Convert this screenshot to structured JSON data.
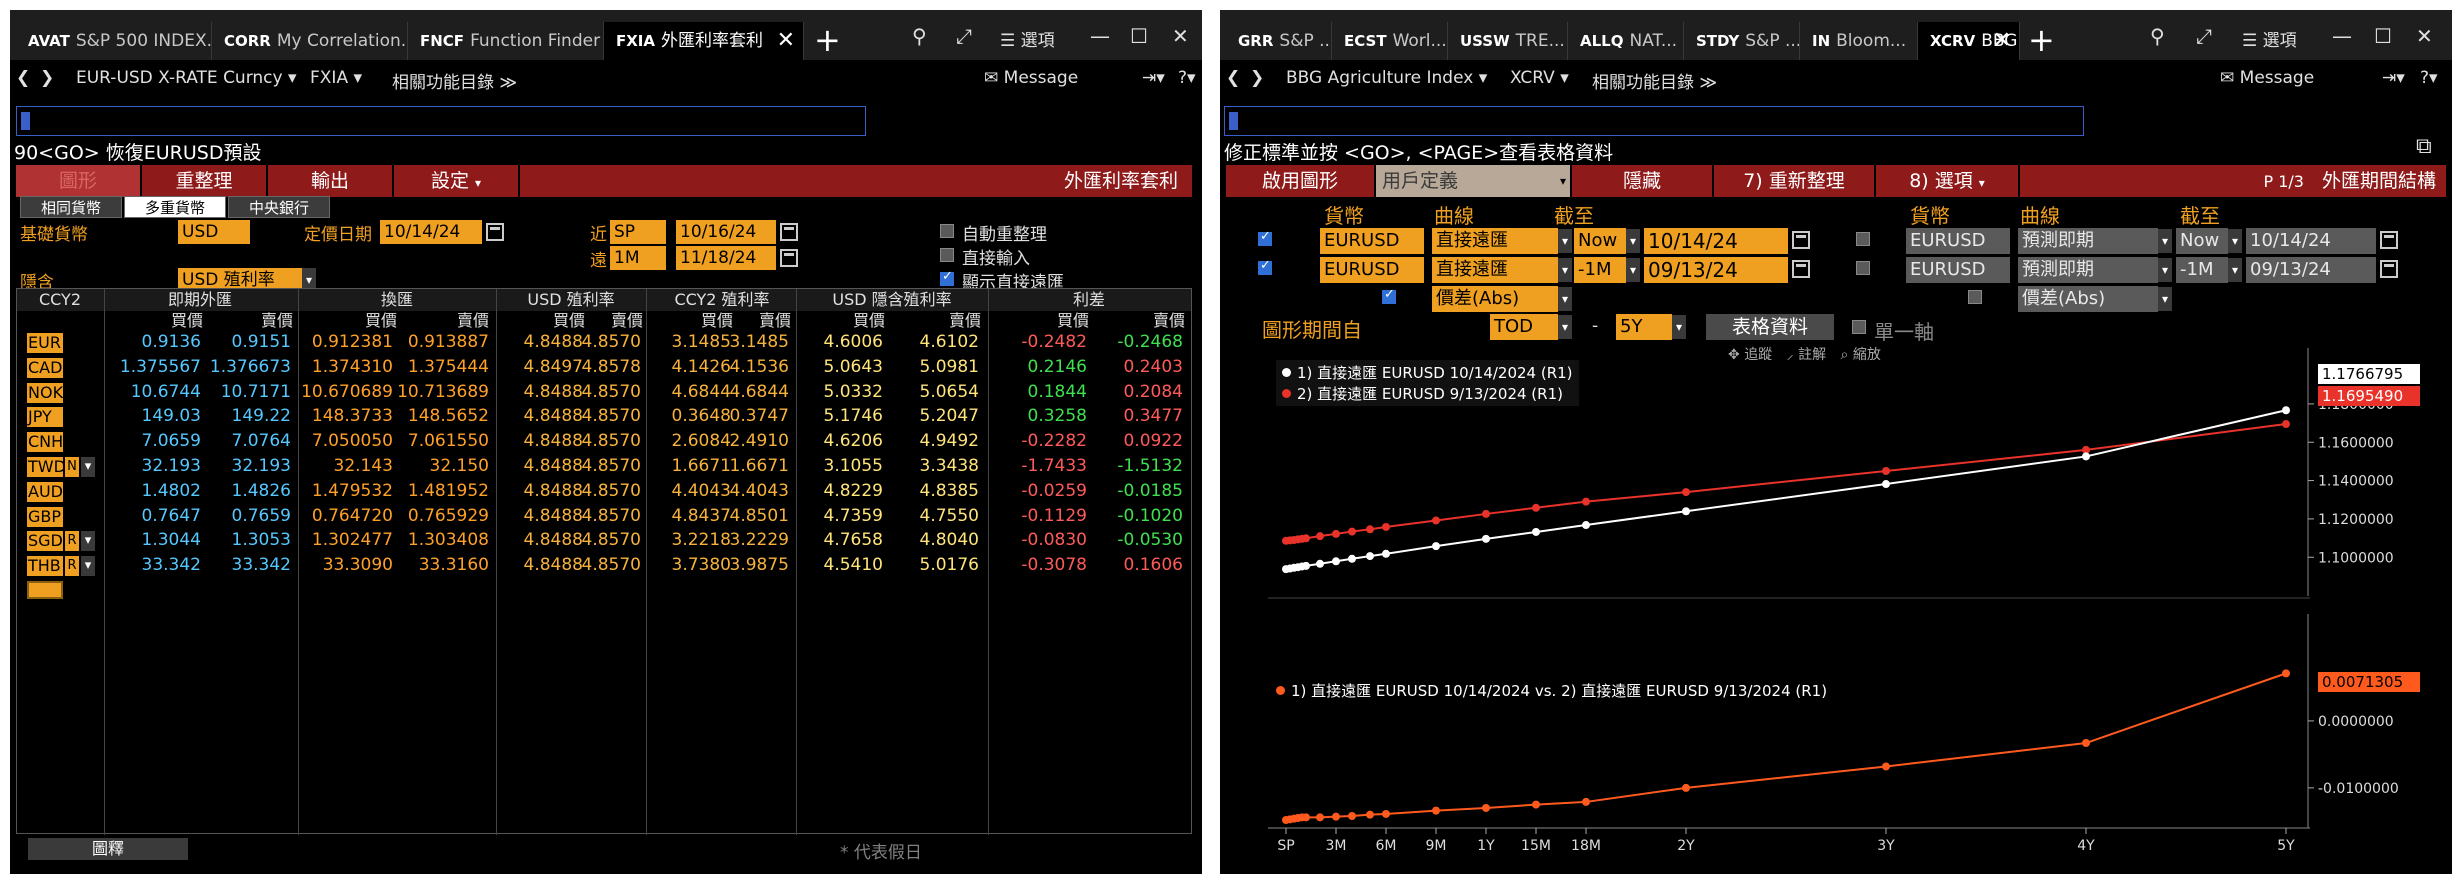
{
  "left": {
    "tabs": [
      {
        "code": "AVAT",
        "label": "S&P 500 INDEX..."
      },
      {
        "code": "CORR",
        "label": "My Correlation..."
      },
      {
        "code": "FNCF",
        "label": "Function Finder"
      },
      {
        "code": "FXIA",
        "label": "外匯利率套利"
      }
    ],
    "options_label": "選項",
    "cmdbar": {
      "security": "EUR-USD X-RATE Curncy",
      "function": "FXIA",
      "related": "相關功能目錄",
      "message": "Message"
    },
    "status_line": "90<GO> 恢復EURUSD預設",
    "redbar": {
      "chart": "圖形",
      "reorganize": "重整理",
      "output": "輸出",
      "settings": "設定",
      "title": "外匯利率套利"
    },
    "subtabs": [
      "相同貨幣",
      "多重貨幣",
      "中央銀行"
    ],
    "form": {
      "base_ccy_label": "基礎貨幣",
      "base_ccy_value": "USD",
      "value_date_label": "定價日期",
      "value_date": "10/14/24",
      "near_label": "近",
      "near_tenor": "SP",
      "near_date": "10/16/24",
      "far_label": "遠",
      "far_tenor": "1M",
      "far_date": "11/18/24",
      "implied_label": "隱含",
      "implied_value": "USD 殖利率",
      "opt_auto": "自動重整理",
      "opt_direct": "直接輸入",
      "opt_show": "顯示直接遠匯"
    },
    "table": {
      "headers": {
        "ccy2": "CCY2",
        "spot": "即期外匯",
        "swap": "換匯",
        "usd_yield": "USD 殖利率",
        "ccy2_yield": "CCY2 殖利率",
        "implied": "USD 隱含殖利率",
        "spread": "利差",
        "bid": "買價",
        "ask": "賣價"
      },
      "rows": [
        {
          "ccy": "EUR",
          "sb": "0.9136",
          "sa": "0.9151",
          "wb": "0.912381",
          "wa": "0.913887",
          "ub": "4.8488",
          "ua": "4.8570",
          "cb": "3.1485",
          "ca": "3.1485",
          "ib": "4.6006",
          "ia": "4.6102",
          "pb": "-0.2482",
          "pa": "-0.2468"
        },
        {
          "ccy": "CAD",
          "sb": "1.375567",
          "sa": "1.376673",
          "wb": "1.374310",
          "wa": "1.375444",
          "ub": "4.8497",
          "ua": "4.8578",
          "cb": "4.1426",
          "ca": "4.1536",
          "ib": "5.0643",
          "ia": "5.0981",
          "pb": "0.2146",
          "pa": "0.2403"
        },
        {
          "ccy": "NOK",
          "sb": "10.6744",
          "sa": "10.7171",
          "wb": "10.670689",
          "wa": "10.713689",
          "ub": "4.8488",
          "ua": "4.8570",
          "cb": "4.6844",
          "ca": "4.6844",
          "ib": "5.0332",
          "ia": "5.0654",
          "pb": "0.1844",
          "pa": "0.2084"
        },
        {
          "ccy": "JPY",
          "sb": "149.03",
          "sa": "149.22",
          "wb": "148.3733",
          "wa": "148.5652",
          "ub": "4.8488",
          "ua": "4.8570",
          "cb": "0.3648",
          "ca": "0.3747",
          "ib": "5.1746",
          "ia": "5.2047",
          "pb": "0.3258",
          "pa": "0.3477"
        },
        {
          "ccy": "CNH",
          "sb": "7.0659",
          "sa": "7.0764",
          "wb": "7.050050",
          "wa": "7.061550",
          "ub": "4.8488",
          "ua": "4.8570",
          "cb": "2.6084",
          "ca": "2.4910",
          "ib": "4.6206",
          "ia": "4.9492",
          "pb": "-0.2282",
          "pa": "0.0922"
        },
        {
          "ccy": "TWD",
          "flag": "N",
          "sb": "32.193",
          "sa": "32.193",
          "wb": "32.143",
          "wa": "32.150",
          "ub": "4.8488",
          "ua": "4.8570",
          "cb": "1.6671",
          "ca": "1.6671",
          "ib": "3.1055",
          "ia": "3.3438",
          "pb": "-1.7433",
          "pa": "-1.5132"
        },
        {
          "ccy": "AUD",
          "sb": "1.4802",
          "sa": "1.4826",
          "wb": "1.479532",
          "wa": "1.481952",
          "ub": "4.8488",
          "ua": "4.8570",
          "cb": "4.4043",
          "ca": "4.4043",
          "ib": "4.8229",
          "ia": "4.8385",
          "pb": "-0.0259",
          "pa": "-0.0185"
        },
        {
          "ccy": "GBP",
          "sb": "0.7647",
          "sa": "0.7659",
          "wb": "0.764720",
          "wa": "0.765929",
          "ub": "4.8488",
          "ua": "4.8570",
          "cb": "4.8437",
          "ca": "4.8501",
          "ib": "4.7359",
          "ia": "4.7550",
          "pb": "-0.1129",
          "pa": "-0.1020"
        },
        {
          "ccy": "SGD",
          "flag": "R",
          "sb": "1.3044",
          "sa": "1.3053",
          "wb": "1.302477",
          "wa": "1.303408",
          "ub": "4.8488",
          "ua": "4.8570",
          "cb": "3.2218",
          "ca": "3.2229",
          "ib": "4.7658",
          "ia": "4.8040",
          "pb": "-0.0830",
          "pa": "-0.0530"
        },
        {
          "ccy": "THB",
          "flag": "R",
          "sb": "33.342",
          "sa": "33.342",
          "wb": "33.3090",
          "wa": "33.3160",
          "ub": "4.8488",
          "ua": "4.8570",
          "cb": "3.7380",
          "ca": "3.9875",
          "ib": "4.5410",
          "ia": "5.0176",
          "pb": "-0.3078",
          "pa": "0.1606"
        }
      ]
    },
    "legend_button": "圖釋",
    "holiday_note": "* 代表假日"
  },
  "right": {
    "tabs": [
      {
        "code": "GRR",
        "label": "S&P ..."
      },
      {
        "code": "ECST",
        "label": "Worl..."
      },
      {
        "code": "USSW",
        "label": "TRE..."
      },
      {
        "code": "ALLQ",
        "label": "NAT..."
      },
      {
        "code": "STDY",
        "label": "S&P ..."
      },
      {
        "code": "IN",
        "label": "Bloom..."
      },
      {
        "code": "XCRV",
        "label": "BBG"
      }
    ],
    "options_label": "選項",
    "cmdbar": {
      "security": "BBG Agriculture Index",
      "function": "XCRV",
      "related": "相關功能目錄",
      "message": "Message"
    },
    "status_line": "修正標準並按 <GO>, <PAGE>查看表格資料",
    "redbar": {
      "enable_chart": "啟用圖形",
      "chart_type": "用戶定義",
      "hide": "隱藏",
      "refresh": "7) 重新整理",
      "options": "8) 選項",
      "page": "P 1/3",
      "title": "外匯期間結構"
    },
    "form": {
      "h_ccy": "貨幣",
      "h_curve": "曲線",
      "h_asof": "截至",
      "r1": {
        "ccy": "EURUSD",
        "curve": "直接遠匯",
        "rel": "Now",
        "date": "10/14/24"
      },
      "r2": {
        "ccy": "EURUSD",
        "curve": "直接遠匯",
        "rel": "-1M",
        "date": "09/13/24"
      },
      "r3": {
        "curve": "價差(Abs)"
      },
      "g1": {
        "ccy": "EURUSD",
        "curve": "預測即期",
        "rel": "Now",
        "date": "10/14/24"
      },
      "g2": {
        "ccy": "EURUSD",
        "curve": "預測即期",
        "rel": "-1M",
        "date": "09/13/24"
      },
      "g3": {
        "curve": "價差(Abs)"
      },
      "period_label": "圖形期間自",
      "period_from": "TOD",
      "period_dash": "-",
      "period_to": "5Y",
      "table_btn": "表格資料",
      "single_axis": "單一軸"
    },
    "chart_tools": [
      "追蹤",
      "註解",
      "縮放"
    ],
    "legend_top": [
      "1) 直接遠匯 EURUSD 10/14/2024 (R1)",
      "2) 直接遠匯 EURUSD 9/13/2024 (R1)"
    ],
    "legend_bottom": "1) 直接遠匯 EURUSD 10/14/2024 vs. 2) 直接遠匯 EURUSD 9/13/2024 (R1)",
    "tag_last1": "1.1766795",
    "tag_last2": "1.1695490",
    "tag_last3": "0.0071305",
    "colors": {
      "series1": "#ffffff",
      "series2": "#e8322a",
      "spread": "#ff5a1e",
      "accent": "#f0a020",
      "redbar": "#8f1a1a"
    }
  },
  "chart_data": [
    {
      "type": "line",
      "x": [
        0,
        0.02,
        0.04,
        0.06,
        0.08,
        0.1,
        0.17,
        0.25,
        0.33,
        0.42,
        0.5,
        0.75,
        1,
        1.25,
        1.5,
        2,
        3,
        4,
        5
      ],
      "x_ticks": [
        "SP",
        "3M",
        "6M",
        "9M",
        "1Y",
        "15M",
        "18M",
        "2Y",
        "3Y",
        "4Y",
        "5Y"
      ],
      "x_tick_pos": [
        0,
        0.25,
        0.5,
        0.75,
        1,
        1.25,
        1.5,
        2,
        3,
        4,
        5
      ],
      "ylim": [
        1.085,
        1.205
      ],
      "y_ticks": [
        "1.1000000",
        "1.1200000",
        "1.1400000",
        "1.1600000",
        "1.1800000"
      ],
      "y_tick_vals": [
        1.1,
        1.12,
        1.14,
        1.16,
        1.18
      ],
      "series": [
        {
          "name": "1) 直接遠匯 EURUSD 10/14/2024 (R1)",
          "values": [
            1.0938,
            1.0941,
            1.0945,
            1.0948,
            1.0952,
            1.0955,
            1.0966,
            1.0979,
            1.0992,
            1.1006,
            1.1018,
            1.1058,
            1.1096,
            1.1132,
            1.1168,
            1.124,
            1.1382,
            1.1526,
            1.1767
          ]
        },
        {
          "name": "2) 直接遠匯 EURUSD 9/13/2024 (R1)",
          "values": [
            1.1086,
            1.1088,
            1.109,
            1.1093,
            1.1096,
            1.1099,
            1.111,
            1.1122,
            1.1134,
            1.1146,
            1.1158,
            1.1192,
            1.1226,
            1.1258,
            1.129,
            1.134,
            1.145,
            1.156,
            1.1695
          ]
        }
      ]
    },
    {
      "type": "line",
      "x": [
        0,
        0.02,
        0.04,
        0.06,
        0.08,
        0.1,
        0.17,
        0.25,
        0.33,
        0.42,
        0.5,
        0.75,
        1,
        1.25,
        1.5,
        2,
        3,
        4,
        5
      ],
      "ylim": [
        -0.0145,
        0.0085
      ],
      "y_ticks": [
        "0.0000000",
        "-0.0100000"
      ],
      "y_tick_vals": [
        0,
        -0.01
      ],
      "series": [
        {
          "name": "1) 直接遠匯 EURUSD 10/14/2024 vs. 2) 直接遠匯 EURUSD 9/13/2024 (R1)",
          "values": [
            -0.0148,
            -0.0147,
            -0.0146,
            -0.0145,
            -0.0144,
            -0.0144,
            -0.0144,
            -0.0143,
            -0.0142,
            -0.014,
            -0.0139,
            -0.0134,
            -0.013,
            -0.0125,
            -0.0121,
            -0.01,
            -0.0068,
            -0.0033,
            0.0071
          ]
        }
      ]
    }
  ]
}
